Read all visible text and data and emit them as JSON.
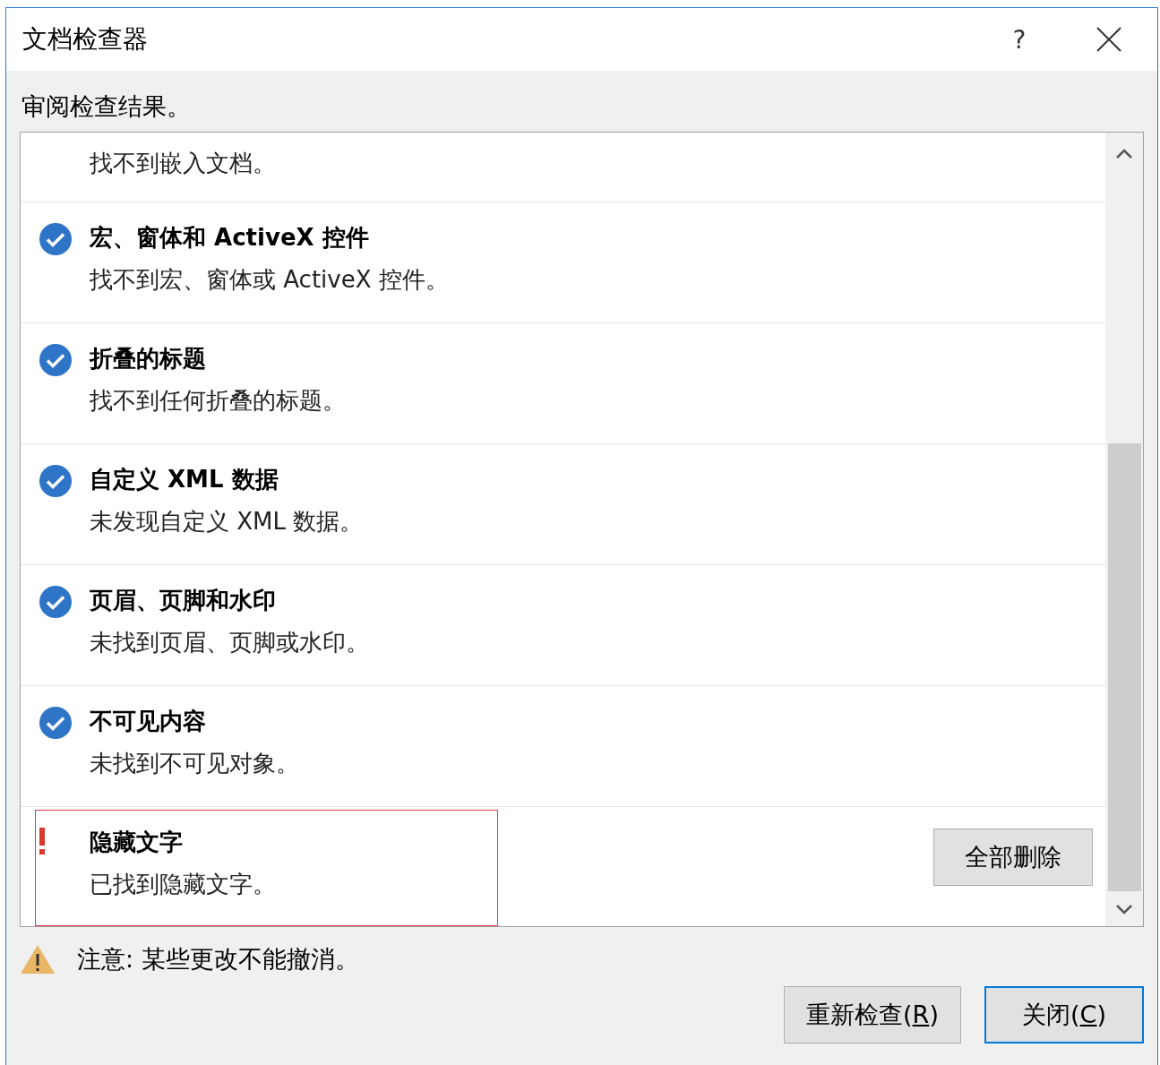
{
  "window": {
    "title": "文档检查器",
    "help": "?"
  },
  "instruction": "审阅检查结果。",
  "results": [
    {
      "kind": "passed",
      "description": "找不到嵌入文档。"
    },
    {
      "kind": "passed",
      "title": "宏、窗体和 ActiveX 控件",
      "description": "找不到宏、窗体或 ActiveX 控件。"
    },
    {
      "kind": "passed",
      "title": "折叠的标题",
      "description": "找不到任何折叠的标题。"
    },
    {
      "kind": "passed",
      "title": "自定义 XML 数据",
      "description": "未发现自定义 XML 数据。"
    },
    {
      "kind": "passed",
      "title": "页眉、页脚和水印",
      "description": "未找到页眉、页脚或水印。"
    },
    {
      "kind": "passed",
      "title": "不可见内容",
      "description": "未找到不可见对象。"
    },
    {
      "kind": "issue",
      "title": "隐藏文字",
      "description": "已找到隐藏文字。",
      "highlighted": true,
      "action": "全部删除"
    }
  ],
  "warning": "注意: 某些更改不能撤消。",
  "buttons": [
    {
      "label_before": "重新检查(",
      "access_key": "R",
      "label_after": ")",
      "default": false
    },
    {
      "label_before": "关闭(",
      "access_key": "C",
      "label_after": ")",
      "default": true
    }
  ]
}
